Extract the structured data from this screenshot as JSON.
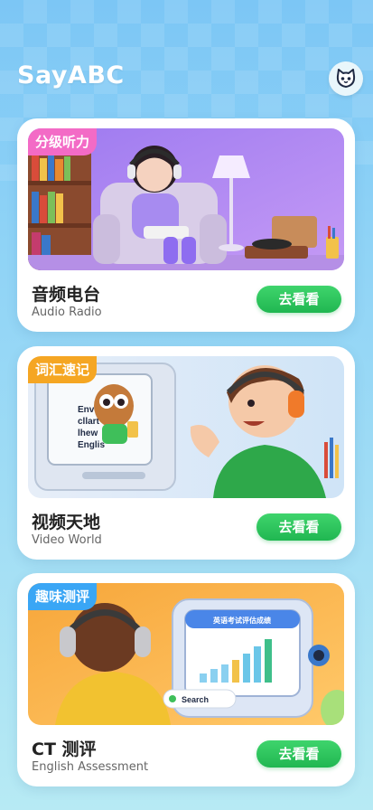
{
  "app": {
    "logo": "SayABC"
  },
  "header": {
    "avatar_icon": "cat-face-icon"
  },
  "cards": [
    {
      "tag": "分级听力",
      "tag_color": "#f36bc6",
      "title": "音频电台",
      "subtitle": "Audio Radio",
      "cta": "去看看",
      "image": "girl-listening-radio-illustration"
    },
    {
      "tag": "词汇速记",
      "tag_color": "#f5a623",
      "title": "视频天地",
      "subtitle": "Video World",
      "cta": "去看看",
      "image": "boy-watching-tv-illustration",
      "screen_text": "Envv cllart lhew Englis"
    },
    {
      "tag": "趣味测评",
      "tag_color": "#3aa6f5",
      "title": "CT 测评",
      "subtitle": "English Assessment",
      "cta": "去看看",
      "image": "boy-taking-test-illustration",
      "screen_title": "英语考试评估成绩",
      "search_label": "Search"
    }
  ],
  "colors": {
    "cta_green": "#28c05a",
    "card_bg": "#ffffff",
    "page_bg": "#8fd3f6"
  }
}
